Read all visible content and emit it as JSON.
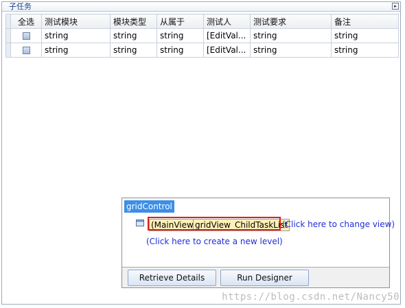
{
  "groupbox": {
    "title": "子任务",
    "collapse_glyph": "▸"
  },
  "grid": {
    "headers": [
      "全选",
      "测试模块",
      "模块类型",
      "从属于",
      "测试人",
      "测试要求",
      "备注"
    ],
    "rows": [
      [
        "string",
        "string",
        "[EditVal...",
        "string",
        "string"
      ],
      [
        "string",
        "string",
        "[EditVal...",
        "string",
        "string"
      ]
    ],
    "row_cells": [
      [
        "string",
        "string",
        "string",
        "[EditVal...",
        "string",
        "string"
      ],
      [
        "string",
        "string",
        "string",
        "[EditVal...",
        "string",
        "string"
      ]
    ]
  },
  "designer": {
    "title": "gridControl",
    "main_view": "(MainView)",
    "view_name": "gridView_ChildTaskList",
    "change_view_link": "(Click here to change view)",
    "new_level_link": "(Click here to create a new level)",
    "retrieve_button": "Retrieve Details",
    "run_designer_button": "Run Designer"
  },
  "watermark": "https://blog.csdn.net/Nancy50"
}
